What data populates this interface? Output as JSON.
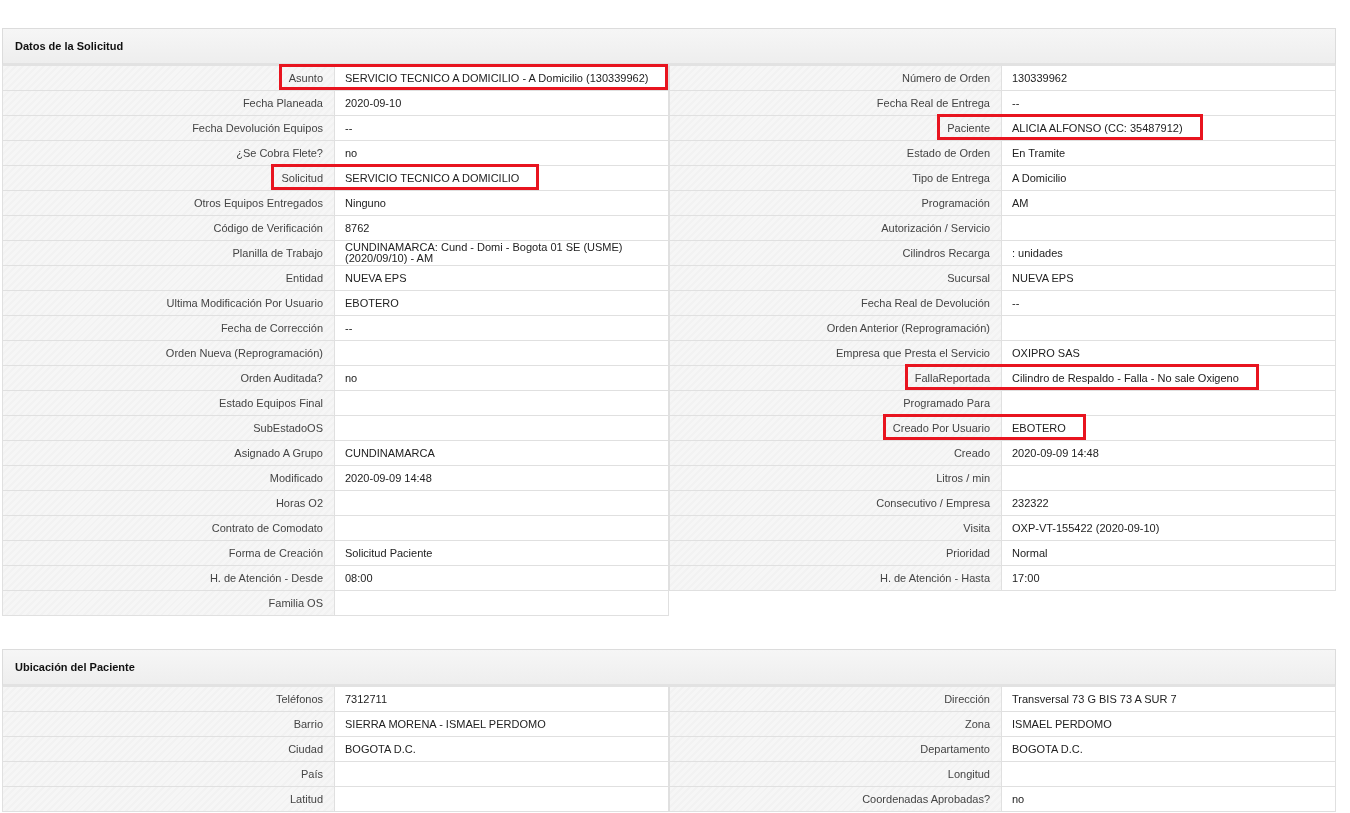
{
  "sections": [
    {
      "title": "Datos de la Solicitud",
      "left": [
        {
          "label": "Asunto",
          "value": "SERVICIO TECNICO A DOMICILIO - A Domicilio (130339962)",
          "highlighted": true
        },
        {
          "label": "Fecha Planeada",
          "value": "2020-09-10",
          "highlighted": false
        },
        {
          "label": "Fecha Devolución Equipos",
          "value": "--",
          "highlighted": false
        },
        {
          "label": "¿Se Cobra Flete?",
          "value": "no",
          "highlighted": false
        },
        {
          "label": "Solicitud",
          "value": "SERVICIO TECNICO A DOMICILIO",
          "highlighted": true
        },
        {
          "label": "Otros Equipos Entregados",
          "value": "Ninguno",
          "highlighted": false
        },
        {
          "label": "Código de Verificación",
          "value": "8762",
          "highlighted": false
        },
        {
          "label": "Planilla de Trabajo",
          "value": "CUNDINAMARCA: Cund - Domi - Bogota 01 SE (USME) (2020/09/10) - AM",
          "highlighted": false
        },
        {
          "label": "Entidad",
          "value": "NUEVA EPS",
          "highlighted": false
        },
        {
          "label": "Ultima Modificación Por Usuario",
          "value": "EBOTERO",
          "highlighted": false
        },
        {
          "label": "Fecha de Corrección",
          "value": "--",
          "highlighted": false
        },
        {
          "label": "Orden Nueva (Reprogramación)",
          "highlighted": false
        },
        {
          "label": "Orden Auditada?",
          "value": "no",
          "highlighted": false
        },
        {
          "label": "Estado Equipos Final",
          "highlighted": false
        },
        {
          "label": "SubEstadoOS",
          "highlighted": false
        },
        {
          "label": "Asignado A Grupo",
          "value": "CUNDINAMARCA",
          "highlighted": false
        },
        {
          "label": "Modificado",
          "value": "2020-09-09 14:48",
          "highlighted": false
        },
        {
          "label": "Horas O2",
          "highlighted": false
        },
        {
          "label": "Contrato de Comodato",
          "highlighted": false
        },
        {
          "label": "Forma de Creación",
          "value": "Solicitud Paciente",
          "highlighted": false
        },
        {
          "label": "H. de Atención - Desde",
          "value": "08:00",
          "highlighted": false
        },
        {
          "label": "Familia OS",
          "highlighted": false
        }
      ],
      "right": [
        {
          "label": "Número de Orden",
          "value": "130339962",
          "highlighted": false
        },
        {
          "label": "Fecha Real de Entrega",
          "value": "--",
          "highlighted": false
        },
        {
          "label": "Paciente",
          "value": "ALICIA ALFONSO (CC: 35487912)",
          "highlighted": true
        },
        {
          "label": "Estado de Orden",
          "value": "En Tramite",
          "highlighted": false
        },
        {
          "label": "Tipo de Entrega",
          "value": "A Domicilio",
          "highlighted": false
        },
        {
          "label": "Programación",
          "value": "AM",
          "highlighted": false
        },
        {
          "label": "Autorización / Servicio",
          "highlighted": false
        },
        {
          "label": "Cilindros Recarga",
          "value": ": unidades",
          "highlighted": false
        },
        {
          "label": "Sucursal",
          "value": "NUEVA EPS",
          "highlighted": false
        },
        {
          "label": "Fecha Real de Devolución",
          "value": "--",
          "highlighted": false
        },
        {
          "label": "Orden Anterior (Reprogramación)",
          "highlighted": false
        },
        {
          "label": "Empresa que Presta el Servicio",
          "value": "OXIPRO SAS",
          "highlighted": false
        },
        {
          "label": "FallaReportada",
          "value": "Cilindro de Respaldo - Falla - No sale Oxigeno",
          "highlighted": true
        },
        {
          "label": "Programado Para",
          "highlighted": false
        },
        {
          "label": "Creado Por Usuario",
          "value": "EBOTERO",
          "highlighted": true
        },
        {
          "label": "Creado",
          "value": "2020-09-09 14:48",
          "highlighted": false
        },
        {
          "label": "Litros / min",
          "highlighted": false
        },
        {
          "label": "Consecutivo / Empresa",
          "value": "232322",
          "highlighted": false
        },
        {
          "label": "Visita",
          "value": "OXP-VT-155422 (2020-09-10)",
          "highlighted": false
        },
        {
          "label": "Prioridad",
          "value": "Normal",
          "highlighted": false
        },
        {
          "label": "H. de Atención - Hasta",
          "value": "17:00",
          "highlighted": false
        }
      ]
    },
    {
      "title": "Ubicación del Paciente",
      "left": [
        {
          "label": "Teléfonos",
          "value": "7312711",
          "highlighted": false
        },
        {
          "label": "Barrio",
          "value": "SIERRA MORENA - ISMAEL PERDOMO",
          "highlighted": false
        },
        {
          "label": "Ciudad",
          "value": "BOGOTA D.C.",
          "highlighted": false
        },
        {
          "label": "País",
          "highlighted": false
        },
        {
          "label": "Latitud",
          "highlighted": false
        }
      ],
      "right": [
        {
          "label": "Dirección",
          "value": "Transversal 73 G BIS 73 A SUR 7",
          "highlighted": false
        },
        {
          "label": "Zona",
          "value": "ISMAEL PERDOMO",
          "highlighted": false
        },
        {
          "label": "Departamento",
          "value": "BOGOTA D.C.",
          "highlighted": false
        },
        {
          "label": "Longitud",
          "highlighted": false
        },
        {
          "label": "Coordenadas Aprobadas?",
          "value": "no",
          "highlighted": false
        }
      ]
    }
  ]
}
